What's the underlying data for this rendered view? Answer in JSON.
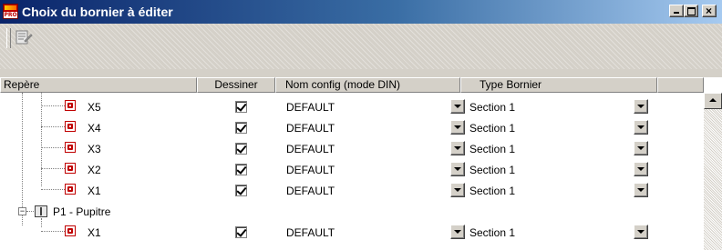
{
  "window": {
    "title": "Choix du bornier à éditer",
    "controls": {
      "minimize": "_",
      "maximize": "□",
      "close": "×"
    }
  },
  "toolbar": {
    "edit_icon": "edit-list-icon"
  },
  "grid": {
    "columns": [
      "Repère",
      "Dessiner",
      "Nom config (mode DIN)",
      "Type Bornier"
    ],
    "rows": [
      {
        "name": "X5",
        "draw": true,
        "config": "DEFAULT",
        "type": "Section 1"
      },
      {
        "name": "X4",
        "draw": true,
        "config": "DEFAULT",
        "type": "Section 1"
      },
      {
        "name": "X3",
        "draw": true,
        "config": "DEFAULT",
        "type": "Section 1"
      },
      {
        "name": "X2",
        "draw": true,
        "config": "DEFAULT",
        "type": "Section 1"
      },
      {
        "name": "X1",
        "draw": true,
        "config": "DEFAULT",
        "type": "Section 1"
      }
    ],
    "group": {
      "label": "P1 - Pupitre",
      "expanded": "−"
    },
    "group_rows": [
      {
        "name": "X1",
        "draw": true,
        "config": "DEFAULT",
        "type": "Section 1"
      }
    ]
  }
}
